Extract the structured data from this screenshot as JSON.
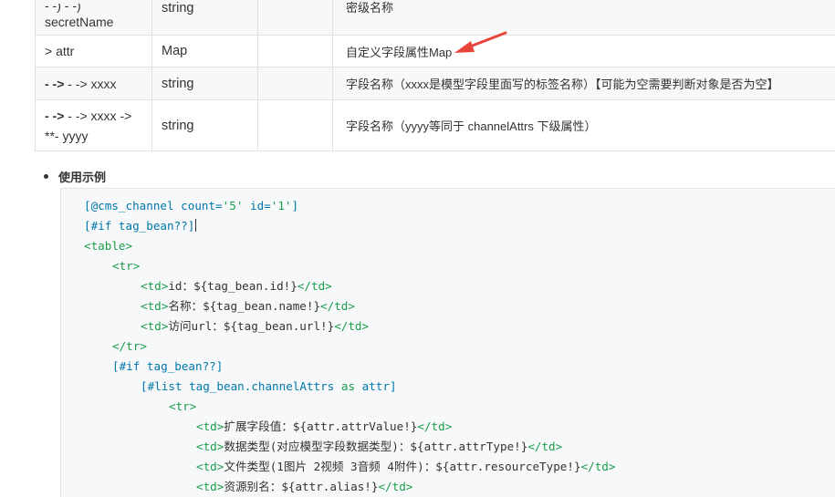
{
  "table": {
    "rows": [
      {
        "name_top": "- -) - -)",
        "name": "secretName",
        "type": "string",
        "required": "",
        "desc": "密级名称"
      },
      {
        "name": "> attr",
        "type": "Map",
        "required": "",
        "desc": "自定义字段属性Map"
      },
      {
        "name_bold": "- ->",
        "name_rest": " - -> xxxx",
        "type": "string",
        "required": "",
        "desc": "字段名称（xxxx是模型字段里面写的标签名称）【可能为空需要判断对象是否为空】"
      },
      {
        "name_bold": "- ->",
        "name_rest": " - -> xxxx ->",
        "name_line2": "**- yyyy",
        "type": "string",
        "required": "",
        "desc": "字段名称（yyyy等同于 channelAttrs 下级属性）"
      }
    ]
  },
  "section": {
    "bullet_label": "使用示例"
  },
  "code": {
    "l1_a": "[@cms_channel count=",
    "l1_b": "'5'",
    "l1_c": " id=",
    "l1_d": "'1'",
    "l1_e": "]",
    "l2": "[#if tag_bean??]",
    "l3": "<table>",
    "l4": "<tr>",
    "l5_open": "<td>",
    "l5_text": "id：${tag_bean.id!}",
    "l5_close": "</td>",
    "l6_open": "<td>",
    "l6_text": "名称：${tag_bean.name!}",
    "l6_close": "</td>",
    "l7_open": "<td>",
    "l7_text": "访问url：${tag_bean.url!}",
    "l7_close": "</td>",
    "l8": "</tr>",
    "l9": "[#if tag_bean??]",
    "l10_a": "[#list tag_bean.channelAttrs ",
    "l10_b": "as",
    "l10_c": " attr]",
    "l11": "<tr>",
    "l12_open": "<td>",
    "l12_text": "扩展字段值：${attr.attrValue!}",
    "l12_close": "</td>",
    "l13_open": "<td>",
    "l13_text": "数据类型(对应模型字段数据类型)：${attr.attrType!}",
    "l13_close": "</td>",
    "l14_open": "<td>",
    "l14_text": "文件类型(1图片 2视频 3音频 4附件)：${attr.resourceType!}",
    "l14_close": "</td>",
    "l15_open": "<td>",
    "l15_text": "资源别名：${attr.alias!}",
    "l15_close": "</td>"
  },
  "colors": {
    "directive": "#0077aa",
    "tag": "#1a9d4a",
    "arrow": "#e8453c",
    "row_shade": "#f6f8fa",
    "border": "#dfe2e5"
  }
}
